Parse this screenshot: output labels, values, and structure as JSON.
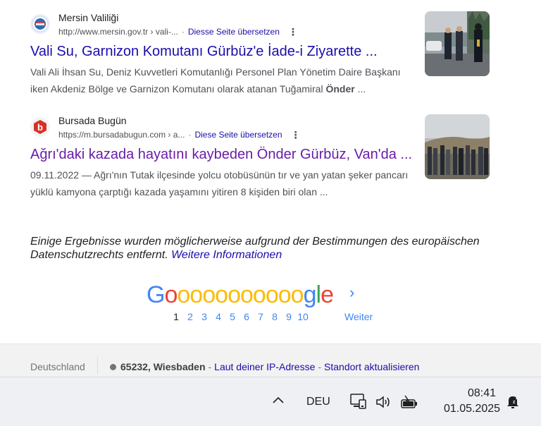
{
  "results": [
    {
      "site_name": "Mersin Valiliği",
      "url": "http://www.mersin.gov.tr › vali-...",
      "translate": "Diesse Seite übersetzen",
      "title": "Vali Su, Garnizon Komutanı Gürbüz'e İade-i Ziyarette ...",
      "snippet_line1": "Vali Ali İhsan Su, Deniz Kuvvetleri Komutanlığı Personel Plan Yönetim Daire Başkanı",
      "snippet_line2_pre": "iken Akdeniz Bölge ve Garnizon Komutanı olarak atanan Tuğamiral ",
      "snippet_line2_bold": "Önder",
      "snippet_line2_post": " ..."
    },
    {
      "site_name": "Bursada Bugün",
      "url": "https://m.bursadabugun.com › a...",
      "translate": "Diese Seite übersetzen",
      "title": "Ağrı'daki kazada hayatını kaybeden Önder Gürbüz, Van'da ...",
      "snippet_line1": "09.11.2022 — Ağrı'nın Tutak ilçesinde yolcu otobüsünün tır ve yan yatan şeker pancarı",
      "snippet_line2": "yüklü kamyona çarptığı kazada yaşamını yitiren 8 kişiden biri olan ..."
    }
  ],
  "notice": {
    "text": "Einige Ergebnisse wurden möglicherweise aufgrund der Bestimmungen des europäischen Datenschutzrechts entfernt.",
    "link": "Weitere Informationen"
  },
  "pagination": {
    "logo_letters": [
      "G",
      "o",
      "o",
      "o",
      "o",
      "o",
      "o",
      "o",
      "o",
      "o",
      "o",
      "o",
      "g",
      "l",
      "e"
    ],
    "logo_colors": [
      "#4285f4",
      "#ea4335",
      "#fbbc05",
      "#fbbc05",
      "#fbbc05",
      "#fbbc05",
      "#fbbc05",
      "#fbbc05",
      "#fbbc05",
      "#fbbc05",
      "#fbbc05",
      "#fbbc05",
      "#4285f4",
      "#34a853",
      "#ea4335"
    ],
    "pages": [
      "1",
      "2",
      "3",
      "4",
      "5",
      "6",
      "7",
      "8",
      "9",
      "10"
    ],
    "current_page": "1",
    "next_label": "Weiter"
  },
  "footer": {
    "country": "Deutschland",
    "location": "65232, Wiesbaden",
    "ip_text": "Laut deiner IP-Adresse",
    "update_text": "Standort aktualisieren"
  },
  "taskbar": {
    "language": "DEU",
    "time": "08:41",
    "date": "01.05.2025"
  },
  "colors": {
    "link": "#1a0dab",
    "visited": "#681da8",
    "text": "#202124",
    "muted": "#4d5156"
  }
}
